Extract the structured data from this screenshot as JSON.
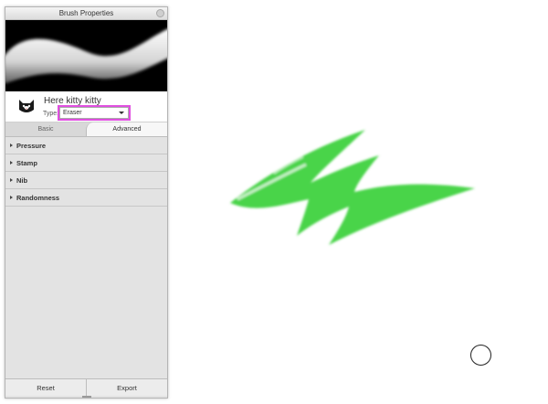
{
  "panel": {
    "title": "Brush Properties",
    "brush_name": "Here kitty kitty",
    "type_label": "Type:",
    "type_value": "Eraser",
    "tabs": [
      {
        "label": "Basic",
        "active": false
      },
      {
        "label": "Advanced",
        "active": true
      }
    ],
    "sections": [
      "Pressure",
      "Stamp",
      "Nib",
      "Randomness"
    ],
    "footer": {
      "reset": "Reset",
      "export": "Export"
    }
  },
  "colors": {
    "stroke": "#3fd23f",
    "type_highlight": "#e04fe0",
    "preview_bg": "#000000"
  },
  "icons": {
    "brush_avatar": "cat-face-icon",
    "cursor": "brush-cursor-ring"
  }
}
